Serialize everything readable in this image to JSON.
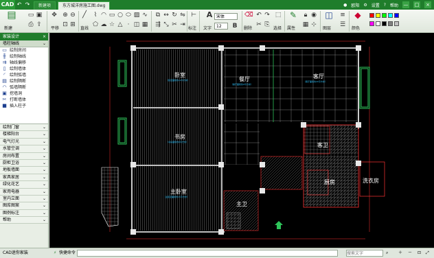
{
  "titlebar": {
    "logo": "CAD",
    "tabs": [
      {
        "label": "新建项"
      },
      {
        "label": "东方城洋房施工图.dwg"
      }
    ],
    "user": "欧阳",
    "settings": "设置",
    "help": "帮助",
    "min": "—",
    "max": "□",
    "close": "×"
  },
  "toolbar": {
    "new_label": "新建",
    "pan_label": "平移",
    "measure_label": "直线",
    "mark_label": "标注",
    "text_label": "文字",
    "font_combo": "宋体",
    "size_combo": "12",
    "erase_label": "删除",
    "select_label": "选择",
    "layers_label": "图层",
    "attr_label": "属性",
    "color_label": "颜色",
    "palette": [
      "#ff0000",
      "#ffff00",
      "#00ff00",
      "#00ffff",
      "#0000ff",
      "#ff00ff",
      "#ffffff",
      "#000000",
      "#808080",
      "#c0c0c0"
    ]
  },
  "leftpanel": {
    "title": "家装设计",
    "subtitle": "墙柱轴线",
    "items": [
      {
        "label": "绘制房间",
        "icon": "▭"
      },
      {
        "label": "绘制轴线",
        "icon": "╫"
      },
      {
        "label": "轴线偏移",
        "icon": "⇉"
      },
      {
        "label": "绘制墙体",
        "icon": "▯"
      },
      {
        "label": "绘制弧墙",
        "icon": "◜"
      },
      {
        "label": "绘制隔断",
        "icon": "▤"
      },
      {
        "label": "弧墙隔断",
        "icon": "◠"
      },
      {
        "label": "挖墙洞",
        "icon": "▣"
      },
      {
        "label": "打断墙体",
        "icon": "✂"
      },
      {
        "label": "插入柱子",
        "icon": "■"
      }
    ],
    "categories": [
      "绘制门窗",
      "楼梯阳台",
      "电气灯光",
      "水管空调",
      "房间布置",
      "厨柜卫浴",
      "地板墙面",
      "家具家居",
      "绿化花艺",
      "家用电器",
      "室内立面",
      "图库图案",
      "图例标注",
      "帮助"
    ]
  },
  "canvas": {
    "rooms": [
      {
        "name": "卧室",
        "sub": "（卧室面积约12平方米）"
      },
      {
        "name": "餐厅",
        "sub": "（餐厅面积约9平方米）"
      },
      {
        "name": "客厅",
        "sub": "（客厅面积约20平方米）"
      },
      {
        "name": "书房",
        "sub": "（书房面积约8平方米）"
      },
      {
        "name": "主卧室",
        "sub": "（主卧室面积约15平方米）"
      },
      {
        "name": "客卫",
        "sub": ""
      },
      {
        "name": "厨房",
        "sub": ""
      },
      {
        "name": "洗衣房",
        "sub": ""
      },
      {
        "name": "主卫",
        "sub": ""
      }
    ]
  },
  "statusbar": {
    "left": "CAD迷你家装",
    "command_label": "快捷命令",
    "search_placeholder": "搜索文字"
  }
}
